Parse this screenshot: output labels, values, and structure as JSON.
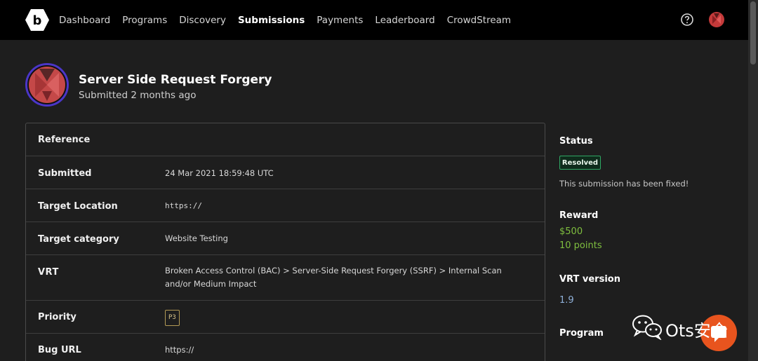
{
  "nav": {
    "items": [
      "Dashboard",
      "Programs",
      "Discovery",
      "Submissions",
      "Payments",
      "Leaderboard",
      "CrowdStream"
    ],
    "active": "Submissions"
  },
  "header": {
    "title": "Server Side Request Forgery",
    "subtitle": "Submitted 2 months ago"
  },
  "details": {
    "rows": [
      {
        "label": "Reference",
        "value": ""
      },
      {
        "label": "Submitted",
        "value": "24 Mar 2021 18:59:48 UTC"
      },
      {
        "label": "Target Location",
        "value": "https://"
      },
      {
        "label": "Target category",
        "value": "Website Testing"
      },
      {
        "label": "VRT",
        "value": "Broken Access Control (BAC) > Server-Side Request Forgery (SSRF) > Internal Scan and/or Medium Impact"
      },
      {
        "label": "Priority",
        "value": "P3"
      },
      {
        "label": "Bug URL",
        "value": "https://"
      }
    ]
  },
  "sidebar": {
    "status_heading": "Status",
    "status_badge": "Resolved",
    "status_note": "This submission has been fixed!",
    "reward_heading": "Reward",
    "reward_amount": "$500",
    "reward_points": "10 points",
    "vrt_version_heading": "VRT  version",
    "vrt_version": "1.9",
    "program_heading": "Program"
  },
  "watermark": {
    "text": "Ots安全"
  },
  "colors": {
    "topbar": "#000000",
    "background": "#1e1e1e",
    "status_green": "#2fa864",
    "reward_green": "#7fbf3f",
    "version_blue": "#8fb0d8",
    "accent_orange": "#e8541e"
  },
  "icons": {
    "logo": "bugcrowd-logo-icon",
    "help": "help-circle-icon",
    "avatar": "user-avatar-icon"
  }
}
